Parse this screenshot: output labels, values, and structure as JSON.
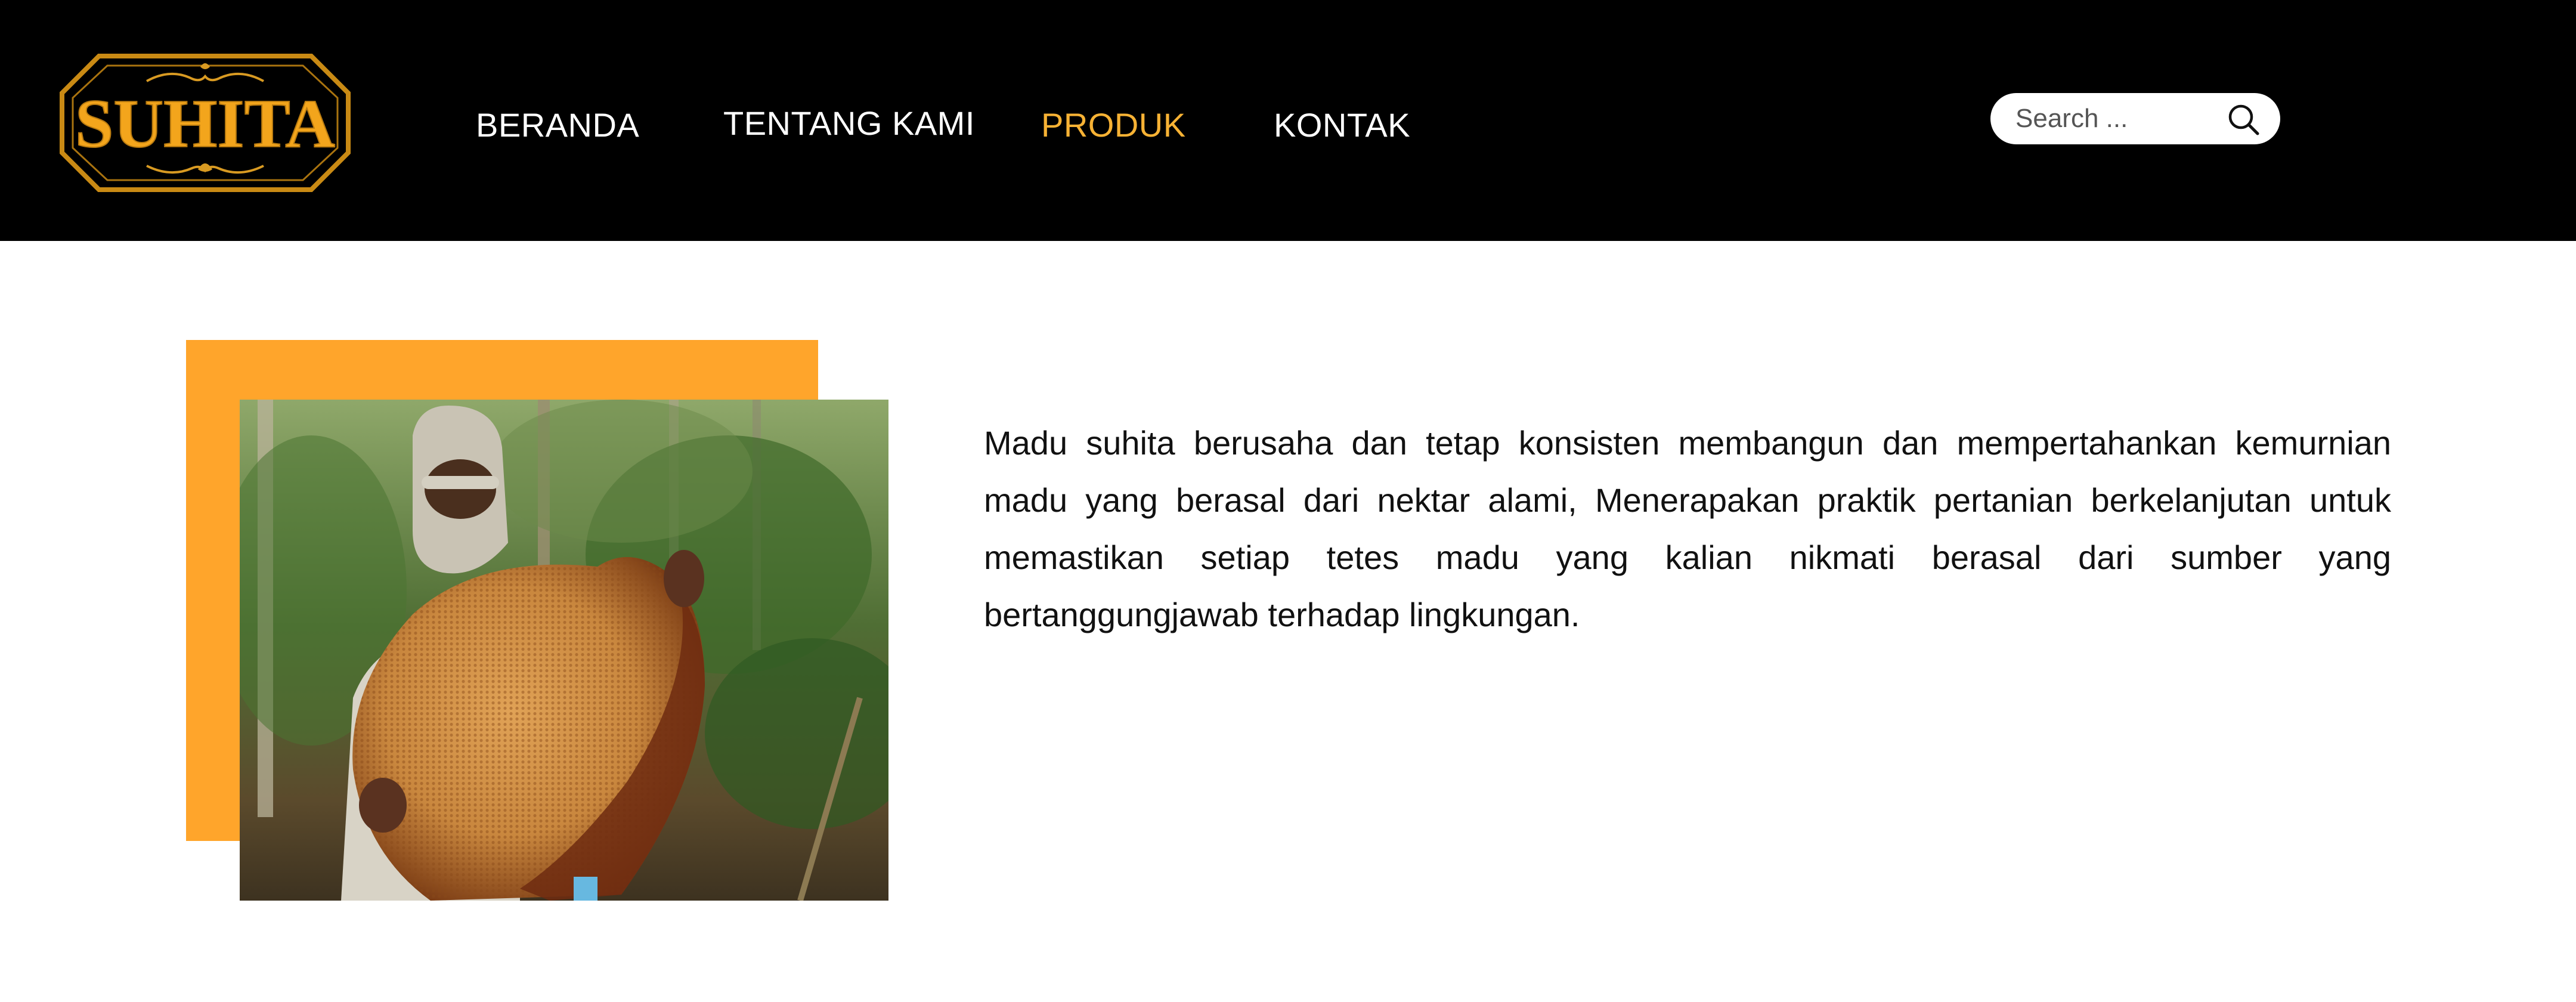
{
  "brand": {
    "logo_text": "SUHITA"
  },
  "nav": {
    "items": [
      {
        "label": "BERANDA",
        "active": false
      },
      {
        "label": "TENTANG KAMI",
        "active": false
      },
      {
        "label": "PRODUK",
        "active": true
      },
      {
        "label": "KONTAK",
        "active": false
      }
    ]
  },
  "search": {
    "placeholder": "Search ...",
    "value": ""
  },
  "content": {
    "paragraph": "Madu suhita berusaha dan tetap konsisten membangun dan mempertahankan kemurnian madu yang berasal dari nektar alami, Menerapakan praktik pertanian berkelanjutan untuk memastikan setiap tetes madu yang kalian nikmati berasal dari sumber yang bertanggungjawab terhadap lingkungan."
  },
  "colors": {
    "header_bg": "#000000",
    "accent": "#f7b234",
    "orange_block": "#ffa52b",
    "logo_gold": "#e59a16"
  },
  "icons": {
    "search": "search-icon"
  }
}
